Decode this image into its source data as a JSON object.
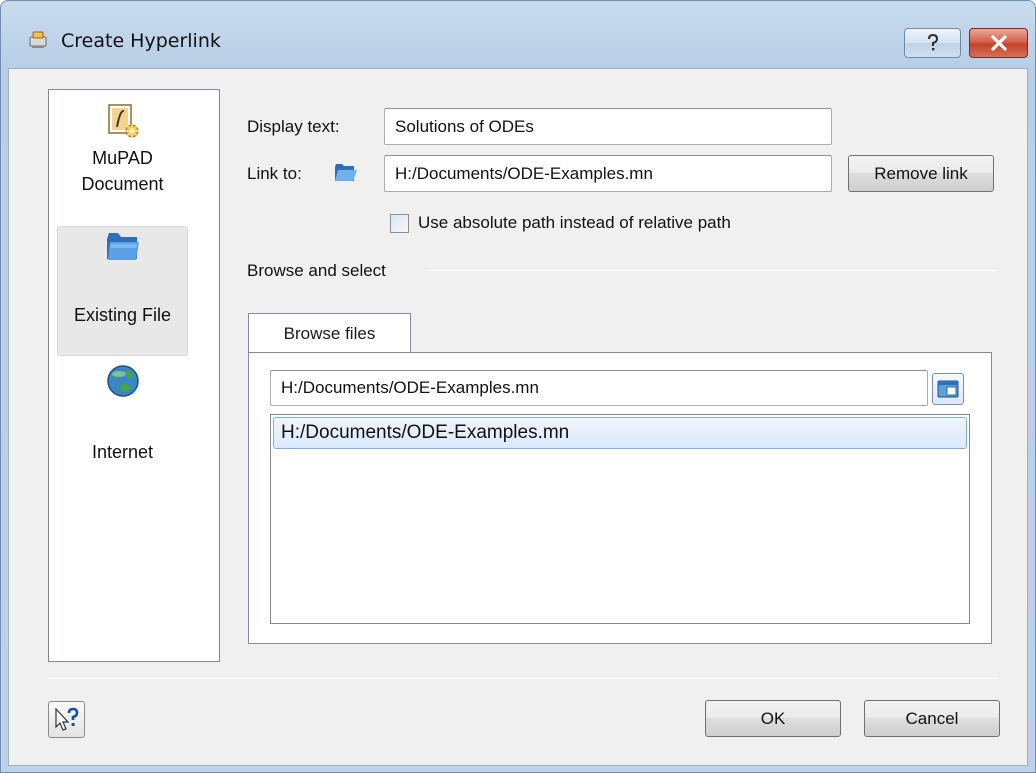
{
  "window": {
    "title": "Create Hyperlink",
    "icons": {
      "title": "hyperlink-icon",
      "help": "question-icon",
      "close": "close-x-icon"
    }
  },
  "categories": [
    {
      "label": "MuPAD Document",
      "line1": "MuPAD",
      "line2": "Document",
      "icon": "mupad-document-icon",
      "selected": false
    },
    {
      "label": "Existing File",
      "icon": "folder-icon",
      "selected": true
    },
    {
      "label": "Internet",
      "icon": "globe-icon",
      "selected": false
    }
  ],
  "form": {
    "display_text_label": "Display text:",
    "display_text_value": "Solutions of ODEs",
    "link_to_label": "Link to:",
    "link_to_value": "H:/Documents/ODE-Examples.mn",
    "remove_link_label": "Remove link",
    "absolute_path_label": "Use absolute path instead of relative path",
    "absolute_path_checked": false
  },
  "browse": {
    "group_label": "Browse and select",
    "tab_label": "Browse files",
    "path_value": "H:/Documents/ODE-Examples.mn",
    "items": [
      "H:/Documents/ODE-Examples.mn"
    ]
  },
  "footer": {
    "ok_label": "OK",
    "cancel_label": "Cancel",
    "help_icon": "context-help-icon"
  },
  "colors": {
    "accent": "#3c7fd1",
    "selection": "#d9e9fb",
    "close": "#c4432a"
  }
}
